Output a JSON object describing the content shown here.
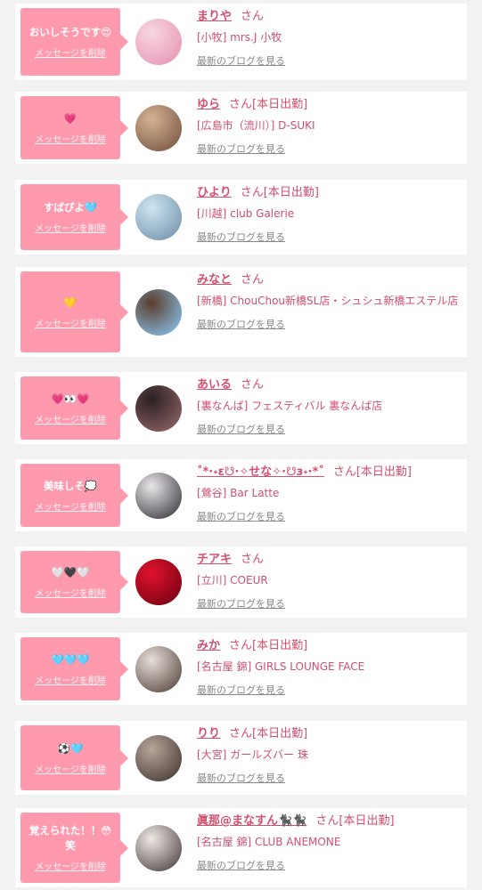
{
  "labels": {
    "delete_message": "メッセージを削除",
    "view_latest_blog": "最新のブログを見る",
    "honorific": "さん",
    "on_duty": "[本日出勤]"
  },
  "items": [
    {
      "message": "おいしそうです😍",
      "name": "まりや",
      "on_duty": false,
      "shop": "[小牧] mrs.J 小牧",
      "avatar": [
        "#f7d7e0",
        "#e58fb0"
      ]
    },
    {
      "message": "💗",
      "name": "ゆら",
      "on_duty": true,
      "shop": "[広島市（流川）] D-SUKI",
      "avatar": [
        "#d6b294",
        "#6e4d3a"
      ]
    },
    {
      "message": "すばぴよ🩵",
      "name": "ひより",
      "on_duty": true,
      "shop": "[川越] club Galerie",
      "avatar": [
        "#cfe6f3",
        "#6a8aa3"
      ]
    },
    {
      "message": "💛",
      "name": "みなと",
      "on_duty": false,
      "shop": "[新橋] ChouChou新橋SL店・シュシュ新橋エステル店",
      "avatar": [
        "#5a3d2b",
        "#8ecfff"
      ]
    },
    {
      "message": "💗👀💗",
      "name": "あいる",
      "on_duty": false,
      "shop": "[裏なんば] フェスティバル 裏なんば店",
      "avatar": [
        "#2a1f22",
        "#9a6b6b"
      ]
    },
    {
      "message": "美味しそ💭",
      "name": "˚*·˖ɛ☋·✧せな✧·☋з˖·*˚",
      "on_duty": true,
      "shop": "[鶯谷] Bar Latte",
      "avatar": [
        "#e9e7ea",
        "#2c2830"
      ]
    },
    {
      "message": "🤍🖤🤍",
      "name": "チアキ",
      "on_duty": false,
      "shop": "[立川] COEUR",
      "avatar": [
        "#e0122e",
        "#6a0010"
      ]
    },
    {
      "message": "🩵🩵🩵",
      "name": "みか",
      "on_duty": true,
      "shop": "[名古屋 錦] GIRLS LOUNGE FACE",
      "avatar": [
        "#e8dfd9",
        "#4a3a33"
      ]
    },
    {
      "message": "⚽🩵",
      "name": "りり",
      "on_duty": true,
      "shop": "[大宮] ガールズバー 珠",
      "avatar": [
        "#b7a59a",
        "#3b2f2a"
      ]
    },
    {
      "message": "覚えられた！！😳笑",
      "name": "眞那@まなすん🐈‍⬛🐈‍⬛",
      "on_duty": true,
      "shop": "[名古屋 錦] CLUB ANEMONE",
      "avatar": [
        "#efe9e6",
        "#3d3534"
      ]
    }
  ]
}
